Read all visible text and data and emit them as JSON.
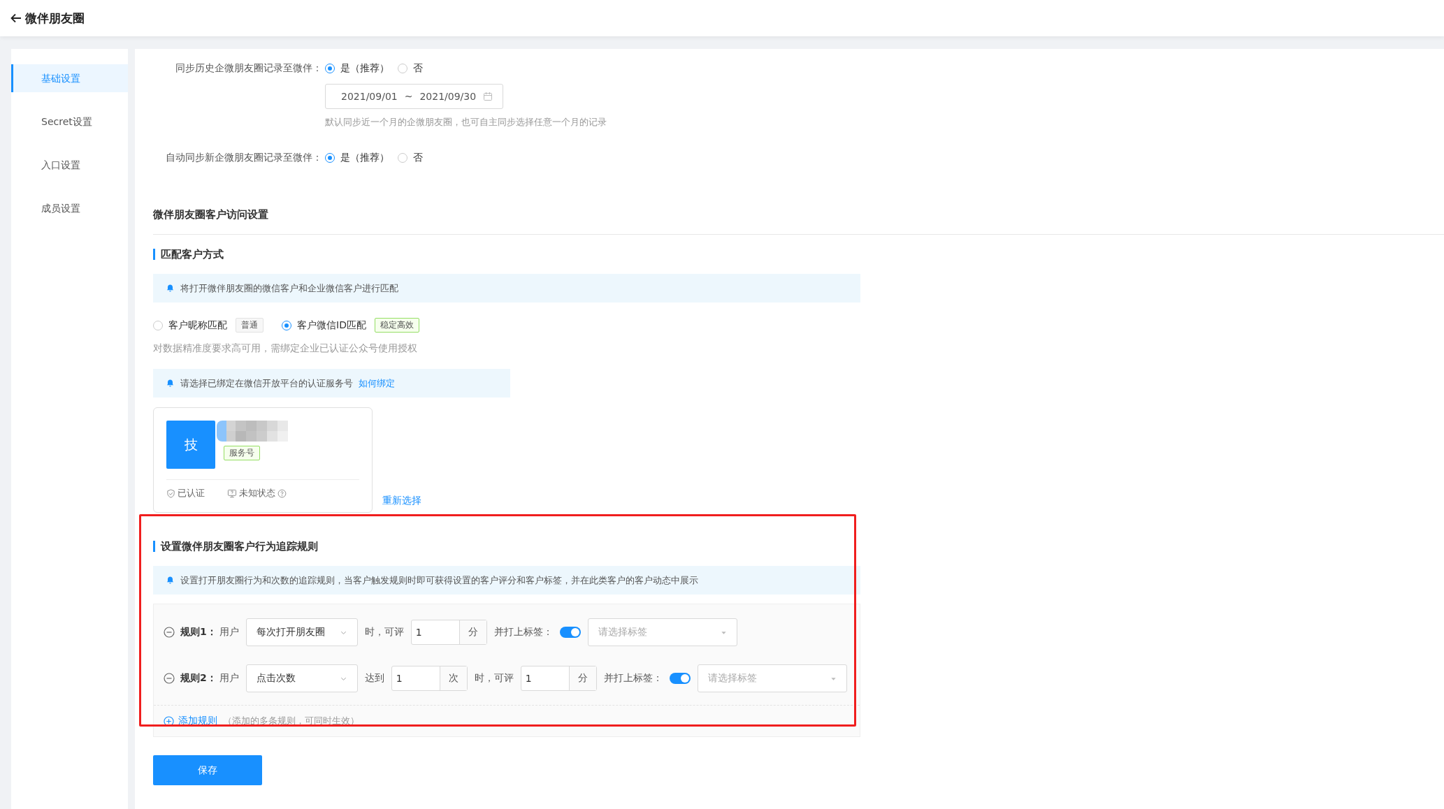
{
  "header": {
    "title": "微伴朋友圈"
  },
  "sidebar": {
    "items": [
      {
        "label": "基础设置",
        "selected": true
      },
      {
        "label": "Secret设置",
        "selected": false
      },
      {
        "label": "入口设置",
        "selected": false
      },
      {
        "label": "成员设置",
        "selected": false
      }
    ]
  },
  "sync_history": {
    "label": "同步历史企微朋友圈记录至微伴：",
    "options": [
      {
        "label": "是（推荐）",
        "selected": true
      },
      {
        "label": "否",
        "selected": false
      }
    ],
    "date_range": {
      "start": "2021/09/01",
      "separator": "~",
      "end": "2021/09/30"
    },
    "hint": "默认同步近一个月的企微朋友圈，也可自主同步选择任意一个月的记录"
  },
  "auto_sync": {
    "label": "自动同步新企微朋友圈记录至微伴：",
    "options": [
      {
        "label": "是（推荐）",
        "selected": true
      },
      {
        "label": "否",
        "selected": false
      }
    ]
  },
  "access_section": {
    "title": "微伴朋友圈客户访问设置"
  },
  "match": {
    "title": "匹配客户方式",
    "notice": "将打开微伴朋友圈的微信客户和企业微信客户进行匹配",
    "options": [
      {
        "label": "客户昵称匹配",
        "tag": "普通",
        "kind": "plain",
        "selected": false
      },
      {
        "label": "客户微信ID匹配",
        "tag": "稳定高效",
        "kind": "success",
        "selected": true
      }
    ],
    "hint": "对数据精准度要求高可用，需绑定企业已认证公众号使用授权",
    "bind_notice": {
      "text": "请选择已绑定在微信开放平台的认证服务号",
      "link": "如何绑定"
    },
    "account": {
      "avatar": "技",
      "type": "服务号",
      "statuses": [
        {
          "kind": "verified",
          "label": "已认证"
        },
        {
          "kind": "unknown",
          "label": "未知状态"
        }
      ],
      "reselect": "重新选择"
    }
  },
  "tracking": {
    "title": "设置微伴朋友圈客户行为追踪规则",
    "notice": "设置打开朋友圈行为和次数的追踪规则，当客户触发规则时即可获得设置的客户评分和客户标签，并在此类客户的客户动态中展示",
    "rules": [
      {
        "label": "规则1：",
        "parts": [
          {
            "kind": "text",
            "text": "用户"
          },
          {
            "kind": "select",
            "value": "每次打开朋友圈"
          },
          {
            "kind": "text",
            "text": "时，可评"
          },
          {
            "kind": "number",
            "value": "1",
            "unit": "分"
          },
          {
            "kind": "text",
            "text": "并打上标签："
          },
          {
            "kind": "toggle",
            "on": true
          },
          {
            "kind": "tag_select",
            "placeholder": "请选择标签"
          }
        ]
      },
      {
        "label": "规则2：",
        "parts": [
          {
            "kind": "text",
            "text": "用户"
          },
          {
            "kind": "select",
            "value": "点击次数"
          },
          {
            "kind": "text",
            "text": "达到"
          },
          {
            "kind": "number",
            "value": "1",
            "unit": "次"
          },
          {
            "kind": "text",
            "text": "时，可评"
          },
          {
            "kind": "number",
            "value": "1",
            "unit": "分"
          },
          {
            "kind": "text",
            "text": "并打上标签："
          },
          {
            "kind": "toggle",
            "on": true
          },
          {
            "kind": "tag_select",
            "placeholder": "请选择标签"
          }
        ]
      }
    ],
    "add_rule": {
      "label": "添加规则",
      "note": "（添加的多条规则，可同时生效）"
    }
  },
  "save": {
    "label": "保存"
  }
}
